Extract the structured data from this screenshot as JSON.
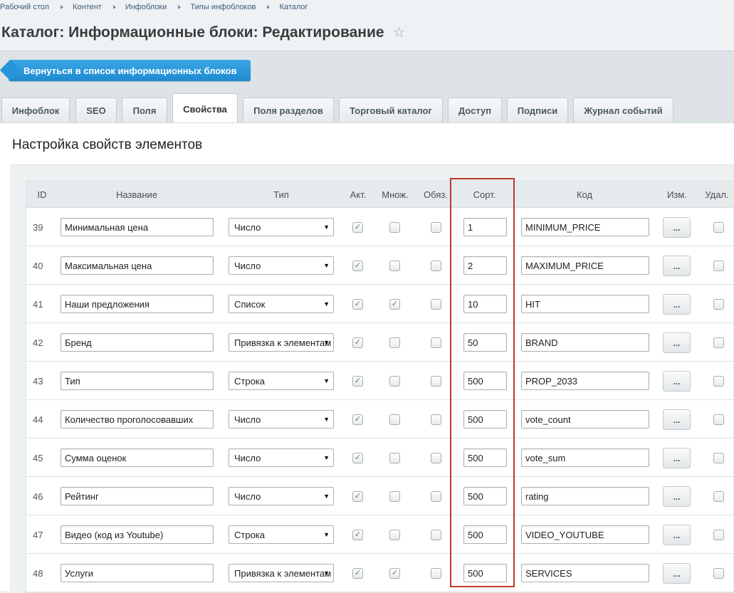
{
  "breadcrumb": [
    "Рабочий стол",
    "Контент",
    "Инфоблоки",
    "Типы инфоблоков",
    "Каталог"
  ],
  "page_title": "Каталог: Информационные блоки: Редактирование",
  "back_button": "Вернуться в список информационных блоков",
  "tabs": [
    "Инфоблок",
    "SEO",
    "Поля",
    "Свойства",
    "Поля разделов",
    "Торговый каталог",
    "Доступ",
    "Подписи",
    "Журнал событий"
  ],
  "active_tab": "Свойства",
  "section_title": "Настройка свойств элементов",
  "columns": {
    "id": "ID",
    "name": "Название",
    "type": "Тип",
    "active": "Акт.",
    "multiple": "Множ.",
    "required": "Обяз.",
    "sort": "Сорт.",
    "code": "Код",
    "edit": "Изм.",
    "delete": "Удал."
  },
  "edit_button_label": "...",
  "rows": [
    {
      "id": "39",
      "name": "Минимальная цена",
      "type": "Число",
      "active": true,
      "multiple": false,
      "required": false,
      "sort": "1",
      "code": "MINIMUM_PRICE",
      "delete": false
    },
    {
      "id": "40",
      "name": "Максимальная цена",
      "type": "Число",
      "active": true,
      "multiple": false,
      "required": false,
      "sort": "2",
      "code": "MAXIMUM_PRICE",
      "delete": false
    },
    {
      "id": "41",
      "name": "Наши предложения",
      "type": "Список",
      "active": true,
      "multiple": true,
      "required": false,
      "sort": "10",
      "code": "HIT",
      "delete": false
    },
    {
      "id": "42",
      "name": "Бренд",
      "type": "Привязка к элементам",
      "active": true,
      "multiple": false,
      "required": false,
      "sort": "50",
      "code": "BRAND",
      "delete": false
    },
    {
      "id": "43",
      "name": "Тип",
      "type": "Строка",
      "active": true,
      "multiple": false,
      "required": false,
      "sort": "500",
      "code": "PROP_2033",
      "delete": false
    },
    {
      "id": "44",
      "name": "Количество проголосовавших",
      "type": "Число",
      "active": true,
      "multiple": false,
      "required": false,
      "sort": "500",
      "code": "vote_count",
      "delete": false
    },
    {
      "id": "45",
      "name": "Сумма оценок",
      "type": "Число",
      "active": true,
      "multiple": false,
      "required": false,
      "sort": "500",
      "code": "vote_sum",
      "delete": false
    },
    {
      "id": "46",
      "name": "Рейтинг",
      "type": "Число",
      "active": true,
      "multiple": false,
      "required": false,
      "sort": "500",
      "code": "rating",
      "delete": false
    },
    {
      "id": "47",
      "name": "Видео (код из Youtube)",
      "type": "Строка",
      "active": true,
      "multiple": false,
      "required": false,
      "sort": "500",
      "code": "VIDEO_YOUTUBE",
      "delete": false
    },
    {
      "id": "48",
      "name": "Услуги",
      "type": "Привязка к элементам",
      "active": true,
      "multiple": true,
      "required": false,
      "sort": "500",
      "code": "SERVICES",
      "delete": false
    }
  ],
  "colors": {
    "accent": "#2596da",
    "highlight": "#c0392b"
  }
}
